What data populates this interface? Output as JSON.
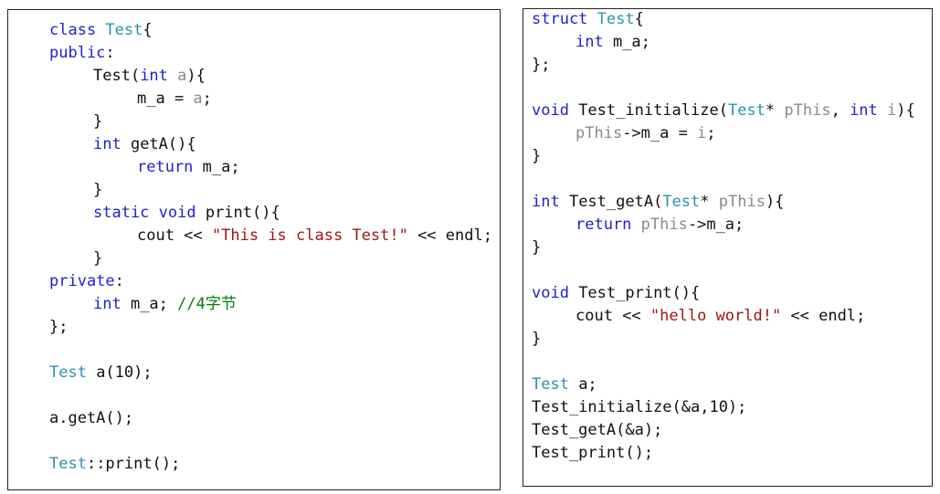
{
  "left_panel": {
    "lines": [
      {
        "indent": 0,
        "tokens": [
          {
            "t": "class ",
            "c": "k"
          },
          {
            "t": "Test",
            "c": "t"
          },
          {
            "t": "{",
            "c": "x"
          }
        ]
      },
      {
        "indent": 0,
        "tokens": [
          {
            "t": "public",
            "c": "k"
          },
          {
            "t": ":",
            "c": "x"
          }
        ]
      },
      {
        "indent": 1,
        "tokens": [
          {
            "t": "Test(",
            "c": "x"
          },
          {
            "t": "int ",
            "c": "k"
          },
          {
            "t": "a",
            "c": "g"
          },
          {
            "t": "){",
            "c": "x"
          }
        ]
      },
      {
        "indent": 2,
        "tokens": [
          {
            "t": "m_a = ",
            "c": "x"
          },
          {
            "t": "a",
            "c": "g"
          },
          {
            "t": ";",
            "c": "x"
          }
        ]
      },
      {
        "indent": 1,
        "tokens": [
          {
            "t": "}",
            "c": "x"
          }
        ]
      },
      {
        "indent": 1,
        "tokens": [
          {
            "t": "int ",
            "c": "k"
          },
          {
            "t": "getA(){",
            "c": "x"
          }
        ]
      },
      {
        "indent": 2,
        "tokens": [
          {
            "t": "return ",
            "c": "k"
          },
          {
            "t": "m_a;",
            "c": "x"
          }
        ]
      },
      {
        "indent": 1,
        "tokens": [
          {
            "t": "}",
            "c": "x"
          }
        ]
      },
      {
        "indent": 1,
        "tokens": [
          {
            "t": "static void ",
            "c": "k"
          },
          {
            "t": "print(){",
            "c": "x"
          }
        ]
      },
      {
        "indent": 2,
        "tokens": [
          {
            "t": "cout << ",
            "c": "x"
          },
          {
            "t": "\"This is class Test!\"",
            "c": "s"
          },
          {
            "t": " << endl;",
            "c": "x"
          }
        ]
      },
      {
        "indent": 1,
        "tokens": [
          {
            "t": "}",
            "c": "x"
          }
        ]
      },
      {
        "indent": 0,
        "tokens": [
          {
            "t": "private",
            "c": "k"
          },
          {
            "t": ":",
            "c": "x"
          }
        ]
      },
      {
        "indent": 1,
        "tokens": [
          {
            "t": "int ",
            "c": "k"
          },
          {
            "t": "m_a; ",
            "c": "x"
          },
          {
            "t": "//4字节",
            "c": "c"
          }
        ]
      },
      {
        "indent": 0,
        "tokens": [
          {
            "t": "};",
            "c": "x"
          }
        ]
      },
      {
        "indent": 0,
        "tokens": []
      },
      {
        "indent": 0,
        "tokens": [
          {
            "t": "Test",
            "c": "t"
          },
          {
            "t": " a(10);",
            "c": "x"
          }
        ]
      },
      {
        "indent": 0,
        "tokens": []
      },
      {
        "indent": 0,
        "tokens": [
          {
            "t": "a.getA();",
            "c": "x"
          }
        ]
      },
      {
        "indent": 0,
        "tokens": []
      },
      {
        "indent": 0,
        "tokens": [
          {
            "t": "Test",
            "c": "t"
          },
          {
            "t": "::print();",
            "c": "x"
          }
        ]
      }
    ]
  },
  "right_panel": {
    "lines": [
      {
        "indent": 0,
        "tokens": [
          {
            "t": "struct ",
            "c": "k"
          },
          {
            "t": "Test",
            "c": "t"
          },
          {
            "t": "{",
            "c": "x"
          }
        ]
      },
      {
        "indent": 1,
        "tokens": [
          {
            "t": "int ",
            "c": "k"
          },
          {
            "t": "m_a;",
            "c": "x"
          }
        ]
      },
      {
        "indent": 0,
        "tokens": [
          {
            "t": "};",
            "c": "x"
          }
        ]
      },
      {
        "indent": 0,
        "tokens": []
      },
      {
        "indent": 0,
        "tokens": [
          {
            "t": "void ",
            "c": "k"
          },
          {
            "t": "Test_initialize(",
            "c": "x"
          },
          {
            "t": "Test",
            "c": "t"
          },
          {
            "t": "* ",
            "c": "x"
          },
          {
            "t": "pThis",
            "c": "g"
          },
          {
            "t": ", ",
            "c": "x"
          },
          {
            "t": "int ",
            "c": "k"
          },
          {
            "t": "i",
            "c": "g"
          },
          {
            "t": "){",
            "c": "x"
          }
        ]
      },
      {
        "indent": 1,
        "tokens": [
          {
            "t": "pThis",
            "c": "g"
          },
          {
            "t": "->m_a = ",
            "c": "x"
          },
          {
            "t": "i",
            "c": "g"
          },
          {
            "t": ";",
            "c": "x"
          }
        ]
      },
      {
        "indent": 0,
        "tokens": [
          {
            "t": "}",
            "c": "x"
          }
        ]
      },
      {
        "indent": 0,
        "tokens": []
      },
      {
        "indent": 0,
        "tokens": [
          {
            "t": "int ",
            "c": "k"
          },
          {
            "t": "Test_getA(",
            "c": "x"
          },
          {
            "t": "Test",
            "c": "t"
          },
          {
            "t": "* ",
            "c": "x"
          },
          {
            "t": "pThis",
            "c": "g"
          },
          {
            "t": "){",
            "c": "x"
          }
        ]
      },
      {
        "indent": 1,
        "tokens": [
          {
            "t": "return ",
            "c": "k"
          },
          {
            "t": "pThis",
            "c": "g"
          },
          {
            "t": "->m_a;",
            "c": "x"
          }
        ]
      },
      {
        "indent": 0,
        "tokens": [
          {
            "t": "}",
            "c": "x"
          }
        ]
      },
      {
        "indent": 0,
        "tokens": []
      },
      {
        "indent": 0,
        "tokens": [
          {
            "t": "void ",
            "c": "k"
          },
          {
            "t": "Test_print(){",
            "c": "x"
          }
        ]
      },
      {
        "indent": 1,
        "tokens": [
          {
            "t": "cout << ",
            "c": "x"
          },
          {
            "t": "\"hello world!\"",
            "c": "s"
          },
          {
            "t": " << endl;",
            "c": "x"
          }
        ]
      },
      {
        "indent": 0,
        "tokens": [
          {
            "t": "}",
            "c": "x"
          }
        ]
      },
      {
        "indent": 0,
        "tokens": []
      },
      {
        "indent": 0,
        "tokens": [
          {
            "t": "Test",
            "c": "t"
          },
          {
            "t": " a;",
            "c": "x"
          }
        ]
      },
      {
        "indent": 0,
        "tokens": [
          {
            "t": "Test_initialize(&a,10);",
            "c": "x"
          }
        ]
      },
      {
        "indent": 0,
        "tokens": [
          {
            "t": "Test_getA(&a);",
            "c": "x"
          }
        ]
      },
      {
        "indent": 0,
        "tokens": [
          {
            "t": "Test_print();",
            "c": "x"
          }
        ]
      }
    ]
  },
  "colors": {
    "keyword": "#1f1fd0",
    "type": "#2b91af",
    "parameter": "#8a8a8a",
    "string": "#a31515",
    "comment": "#008000",
    "text": "#111111"
  }
}
